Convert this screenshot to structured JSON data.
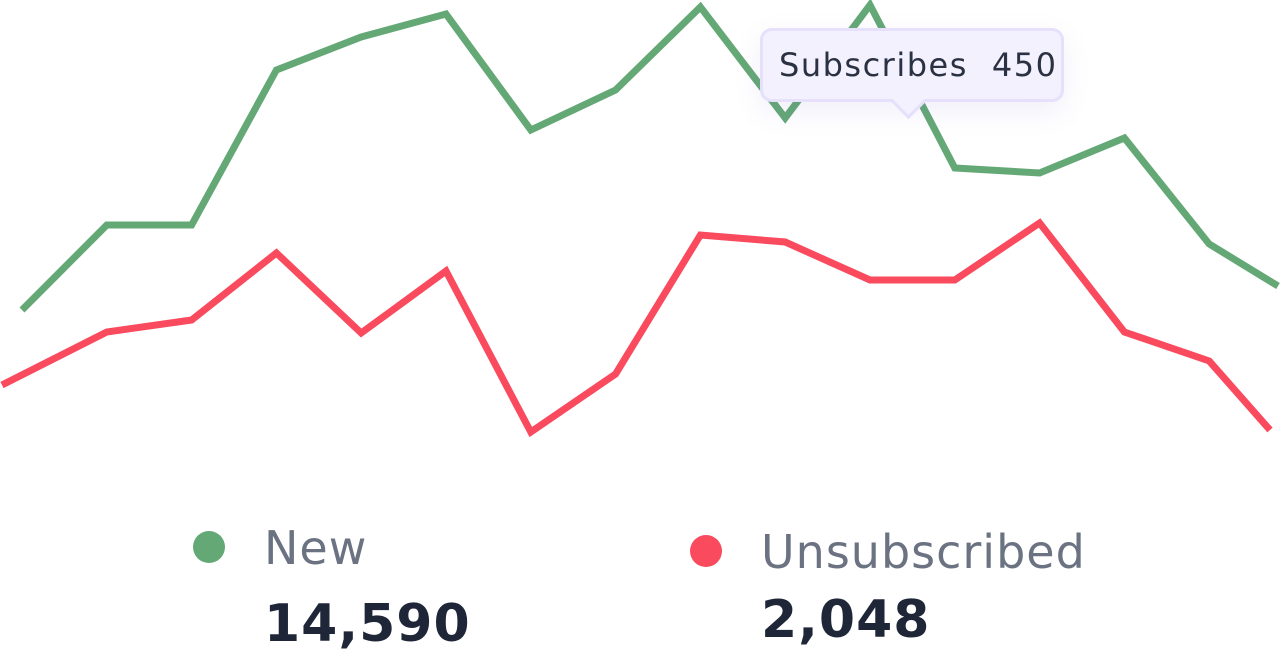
{
  "chart_data": {
    "type": "line",
    "title": "",
    "xlabel": "",
    "ylabel": "",
    "grid": false,
    "x": [
      1,
      2,
      3,
      4,
      5,
      6,
      7,
      8,
      9,
      10,
      11,
      12,
      13,
      14,
      15,
      16
    ],
    "series": [
      {
        "name": "New",
        "color": "#64a876",
        "values": [
          310,
          225,
          225,
          70,
          37,
          14,
          130,
          90,
          7,
          118,
          5,
          168,
          173,
          138,
          244,
          286
        ]
      },
      {
        "name": "Unsubscribed",
        "color": "#fa4a5e",
        "values": [
          385,
          332,
          320,
          253,
          333,
          271,
          432,
          374,
          235,
          242,
          280,
          280,
          223,
          332,
          361,
          430
        ]
      }
    ],
    "tooltip": {
      "label": "Subscribes",
      "value": "450"
    }
  },
  "legend": [
    {
      "label": "New",
      "value": "14,590",
      "color": "#64a876"
    },
    {
      "label": "Unsubscribed",
      "value": "2,048",
      "color": "#fa4a5e"
    }
  ]
}
